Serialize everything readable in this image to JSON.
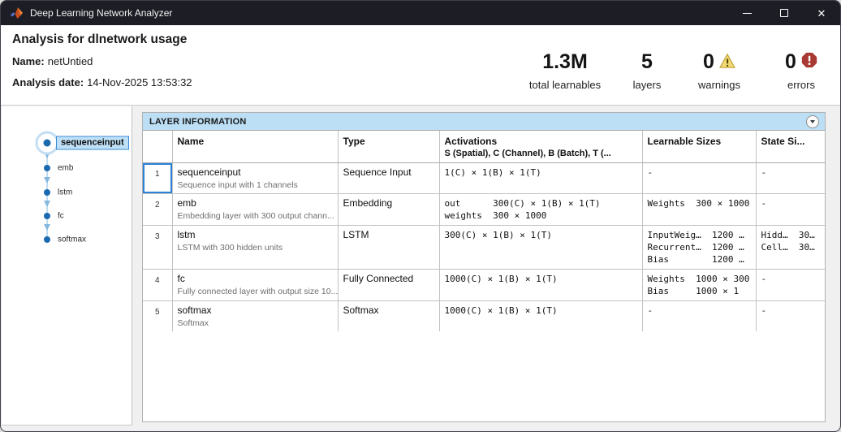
{
  "window": {
    "title": "Deep Learning Network Analyzer"
  },
  "header": {
    "title": "Analysis for dlnetwork usage",
    "name_label": "Name:",
    "name_value": "netUntied",
    "date_label": "Analysis date:",
    "date_value": "14-Nov-2025 13:53:32"
  },
  "stats": [
    {
      "value": "1.3M",
      "label": "total learnables"
    },
    {
      "value": "5",
      "label": "layers"
    },
    {
      "value": "0",
      "label": "warnings",
      "icon": "warning-icon"
    },
    {
      "value": "0",
      "label": "errors",
      "icon": "error-icon"
    }
  ],
  "graph": {
    "nodes": [
      {
        "label": "sequenceinput",
        "selected": true
      },
      {
        "label": "emb"
      },
      {
        "label": "lstm"
      },
      {
        "label": "fc"
      },
      {
        "label": "softmax"
      }
    ]
  },
  "panel": {
    "title": "LAYER INFORMATION"
  },
  "table": {
    "headers": {
      "name": "Name",
      "type": "Type",
      "activations": "Activations",
      "activations_sub": "S (Spatial), C (Channel), B (Batch), T (...",
      "learnables": "Learnable Sizes",
      "states": "State Si..."
    },
    "rows": [
      {
        "num": "1",
        "name": "sequenceinput",
        "desc": "Sequence input with 1 channels",
        "type": "Sequence Input",
        "activations": "1(C) × 1(B) × 1(T)",
        "learnables": "-",
        "states": "-"
      },
      {
        "num": "2",
        "name": "emb",
        "desc": "Embedding layer with 300 output chann...",
        "type": "Embedding",
        "activations": "out      300(C) × 1(B) × 1(T)\nweights  300 × 1000",
        "learnables": "Weights  300 × 1000",
        "states": "-"
      },
      {
        "num": "3",
        "name": "lstm",
        "desc": "LSTM with 300 hidden units",
        "type": "LSTM",
        "activations": "300(C) × 1(B) × 1(T)",
        "learnables": "InputWeig…  1200 …\nRecurrent…  1200 …\nBias        1200 …",
        "states": "Hidd…  30…\nCell…  30…"
      },
      {
        "num": "4",
        "name": "fc",
        "desc": "Fully connected layer with output size 10...",
        "type": "Fully Connected",
        "activations": "1000(C) × 1(B) × 1(T)",
        "learnables": "Weights  1000 × 300\nBias     1000 × 1",
        "states": "-"
      },
      {
        "num": "5",
        "name": "softmax",
        "desc": "Softmax",
        "type": "Softmax",
        "activations": "1000(C) × 1(B) × 1(T)",
        "learnables": "-",
        "states": "-"
      }
    ]
  },
  "colors": {
    "titlebar": "#1d1d26",
    "panel_header_blue": "#bcdff5",
    "selection_blue": "#2b83d8",
    "node_blue": "#1a6ab0",
    "warning_yellow": "#f3da73",
    "error_red": "#a93a33"
  }
}
